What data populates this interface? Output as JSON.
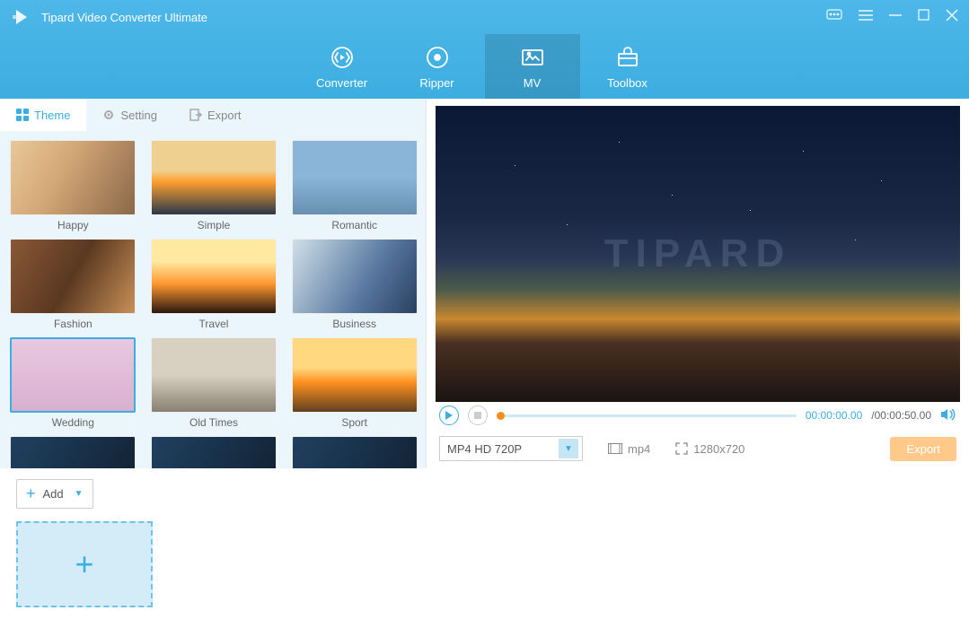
{
  "app_title": "Tipard Video Converter Ultimate",
  "nav": [
    "Converter",
    "Ripper",
    "MV",
    "Toolbox"
  ],
  "nav_active": 2,
  "tabs": [
    "Theme",
    "Setting",
    "Export"
  ],
  "tab_active": 0,
  "themes": [
    {
      "label": "Happy",
      "cls": "t-happy"
    },
    {
      "label": "Simple",
      "cls": "t-simple"
    },
    {
      "label": "Romantic",
      "cls": "t-romantic"
    },
    {
      "label": "Fashion",
      "cls": "t-fashion"
    },
    {
      "label": "Travel",
      "cls": "t-travel"
    },
    {
      "label": "Business",
      "cls": "t-business"
    },
    {
      "label": "Wedding",
      "cls": "t-wedding"
    },
    {
      "label": "Old Times",
      "cls": "t-oldtimes"
    },
    {
      "label": "Sport",
      "cls": "t-sport"
    },
    {
      "label": "",
      "cls": "t-more"
    },
    {
      "label": "",
      "cls": "t-more"
    },
    {
      "label": "",
      "cls": "t-more"
    }
  ],
  "preview_watermark": "TIPARD",
  "player": {
    "current": "00:00:00.00",
    "total": "/00:00:50.00"
  },
  "export": {
    "format": "MP4 HD 720P",
    "container": "mp4",
    "resolution": "1280x720",
    "button": "Export"
  },
  "add_button": "Add"
}
